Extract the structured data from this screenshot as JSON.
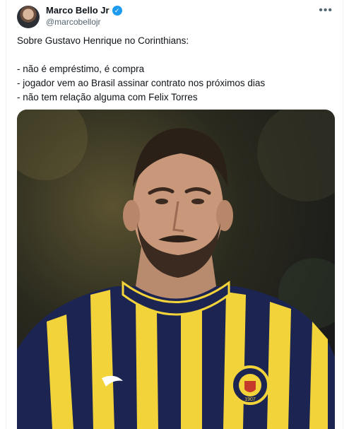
{
  "author": {
    "name": "Marco Bello Jr",
    "handle": "@marcobellojr",
    "verified_icon": "verified-badge-icon",
    "more_icon": "more-options-icon"
  },
  "tweet": {
    "lines": [
      "Sobre Gustavo Henrique no Corinthians:",
      "- não é empréstimo, é compra",
      "- jogador vem ao Brasil assinar contrato nos próximos dias",
      "- não tem relação alguma com Felix Torres"
    ]
  },
  "media": {
    "kit_text": "1907"
  },
  "colors": {
    "verified": "#1d9bf0",
    "handle": "#536471",
    "jersey_navy": "#1c2452",
    "jersey_yellow": "#f2d33a"
  }
}
